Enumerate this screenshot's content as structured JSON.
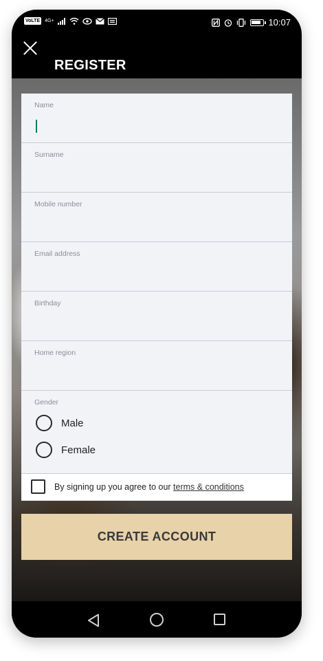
{
  "status_bar": {
    "network_badge": "VoLTE",
    "network_type": "4G+",
    "time": "10:07",
    "icons": [
      "signal-icon",
      "wifi-icon",
      "eye-icon",
      "mail-icon",
      "message-icon",
      "nfc-icon",
      "alarm-icon",
      "vibrate-icon",
      "battery-icon"
    ]
  },
  "header": {
    "title": "REGISTER"
  },
  "form": {
    "fields": [
      {
        "label": "Name",
        "value": ""
      },
      {
        "label": "Surname",
        "value": ""
      },
      {
        "label": "Mobile number",
        "value": ""
      },
      {
        "label": "Email address",
        "value": ""
      },
      {
        "label": "Birthday",
        "value": ""
      },
      {
        "label": "Home region",
        "value": ""
      }
    ],
    "gender": {
      "label": "Gender",
      "options": [
        "Male",
        "Female"
      ]
    },
    "terms": {
      "text": "By signing up you agree to our ",
      "link": "terms & conditions"
    }
  },
  "create_button": "CREATE ACCOUNT",
  "colors": {
    "header_bg": "#000000",
    "form_bg": "#f1f3f7",
    "button_bg": "#e8d2a9",
    "cursor": "#0e7a6d"
  }
}
